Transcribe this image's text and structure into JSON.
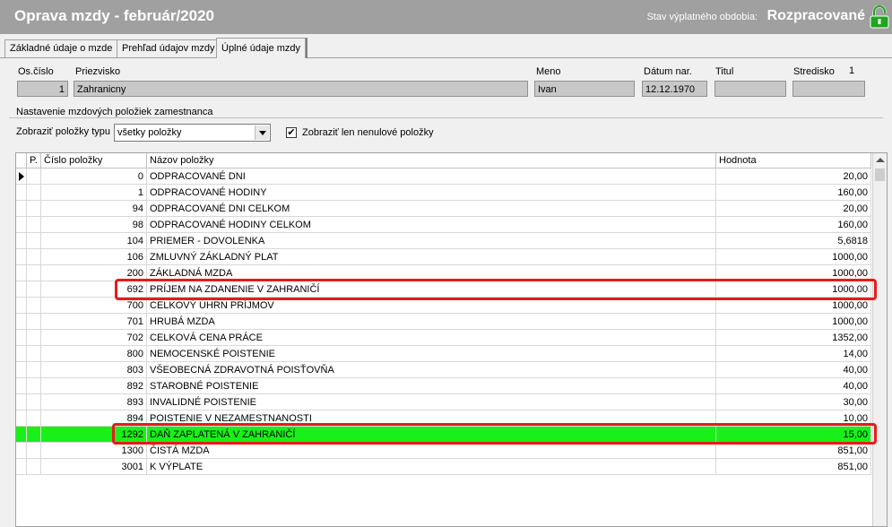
{
  "window": {
    "title": "Oprava mzdy  -  február/2020",
    "period_state_label": "Stav výplatného obdobia:",
    "period_state_value": "Rozpracované"
  },
  "tabs": [
    {
      "label": "Základné údaje o mzde"
    },
    {
      "label": "Prehľad údajov mzdy"
    },
    {
      "label": "Úplné údaje mzdy"
    }
  ],
  "employee": {
    "os_cislo_label": "Os.číslo",
    "os_cislo": "1",
    "priezvisko_label": "Priezvisko",
    "priezvisko": "Zahranicny",
    "meno_label": "Meno",
    "meno": "Ivan",
    "datum_label": "Dátum nar.",
    "datum": "12.12.1970",
    "titul_label": "Titul",
    "titul": "",
    "stredisko_label": "Stredisko",
    "stredisko_value": "1",
    "stredisko": ""
  },
  "settings": {
    "group_title": "Nastavenie mzdových položiek zamestnanca",
    "type_label": "Zobraziť položky typu",
    "type_value": "všetky položky",
    "nonzero_label": "Zobraziť len nenulové položky",
    "nonzero_checked": "✔"
  },
  "table": {
    "headers": [
      "P.",
      "Číslo položky",
      "Názov položky",
      "Hodnota"
    ],
    "rows": [
      {
        "cislo": "0",
        "nazov": "ODPRACOVANÉ DNI",
        "hodnota": "20,00"
      },
      {
        "cislo": "1",
        "nazov": "ODPRACOVANÉ HODINY",
        "hodnota": "160,00"
      },
      {
        "cislo": "94",
        "nazov": "ODPRACOVANÉ DNI CELKOM",
        "hodnota": "20,00"
      },
      {
        "cislo": "98",
        "nazov": "ODPRACOVANÉ HODINY CELKOM",
        "hodnota": "160,00"
      },
      {
        "cislo": "104",
        "nazov": "PRIEMER - DOVOLENKA",
        "hodnota": "5,6818"
      },
      {
        "cislo": "106",
        "nazov": "ZMLUVNÝ ZÁKLADNÝ PLAT",
        "hodnota": "1000,00"
      },
      {
        "cislo": "200",
        "nazov": "ZÁKLADNÁ MZDA",
        "hodnota": "1000,00"
      },
      {
        "cislo": "692",
        "nazov": "PRÍJEM NA ZDANENIE V ZAHRANIČÍ",
        "hodnota": "1000,00"
      },
      {
        "cislo": "700",
        "nazov": "CELKOVÝ ÚHRN PRÍJMOV",
        "hodnota": "1000,00"
      },
      {
        "cislo": "701",
        "nazov": "HRUBÁ MZDA",
        "hodnota": "1000,00"
      },
      {
        "cislo": "702",
        "nazov": "CELKOVÁ CENA PRÁCE",
        "hodnota": "1352,00"
      },
      {
        "cislo": "800",
        "nazov": "NEMOCENSKÉ POISTENIE",
        "hodnota": "14,00"
      },
      {
        "cislo": "803",
        "nazov": "VŠEOBECNÁ ZDRAVOTNÁ POISŤOVŇA",
        "hodnota": "40,00"
      },
      {
        "cislo": "892",
        "nazov": "STAROBNÉ POISTENIE",
        "hodnota": "40,00"
      },
      {
        "cislo": "893",
        "nazov": "INVALIDNÉ POISTENIE",
        "hodnota": "30,00"
      },
      {
        "cislo": "894",
        "nazov": "POISTENIE V NEZAMESTNANOSTI",
        "hodnota": "10,00"
      },
      {
        "cislo": "1292",
        "nazov": "DAŇ ZAPLATENÁ V ZAHRANIČÍ",
        "hodnota": "15,00"
      },
      {
        "cislo": "1300",
        "nazov": "ČISTÁ MZDA",
        "hodnota": "851,00"
      },
      {
        "cislo": "3001",
        "nazov": "K VÝPLATE",
        "hodnota": "851,00"
      }
    ]
  },
  "colors": {
    "highlight_row": "#19f019",
    "annotation_border": "#e81a1a",
    "titlebar": "#a0a0a0",
    "lock_icon": "#1fa51f"
  },
  "icons": {
    "lock": "unlocked-padlock-icon",
    "row_indicator": "row-pointer-icon",
    "dropdown": "chevron-down-icon"
  }
}
